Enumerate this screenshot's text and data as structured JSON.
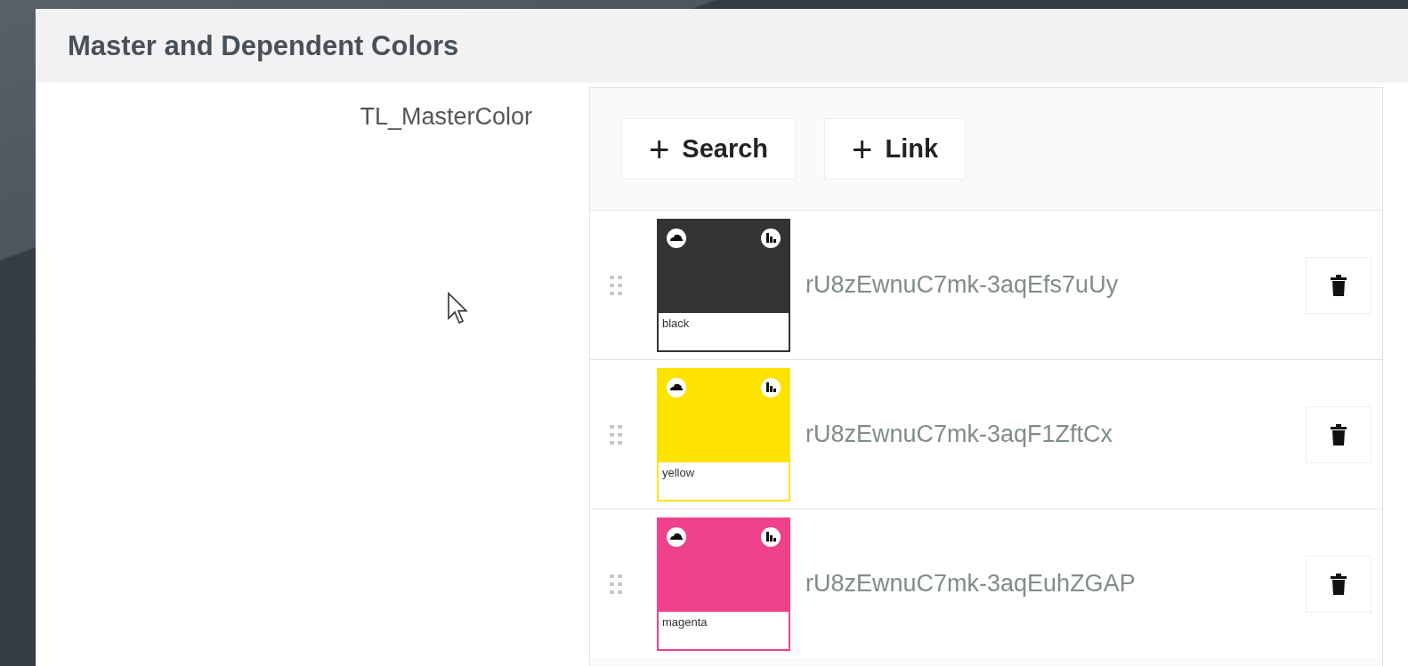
{
  "panel": {
    "title": "Master and Dependent Colors"
  },
  "field": {
    "label": "TL_MasterColor"
  },
  "toolbar": {
    "buttons": [
      {
        "icon": "+",
        "label": "Search"
      },
      {
        "icon": "+",
        "label": "Link"
      }
    ]
  },
  "links": [
    {
      "swatch_name": "black",
      "color": "#333235",
      "id": "rU8zEwnuC7mk-3aqEfs7uUy"
    },
    {
      "swatch_name": "yellow",
      "color": "#ffe300",
      "id": "rU8zEwnuC7mk-3aqF1ZftCx"
    },
    {
      "swatch_name": "magenta",
      "color": "#f0418b",
      "id": "rU8zEwnuC7mk-3aqEuhZGAP"
    }
  ]
}
